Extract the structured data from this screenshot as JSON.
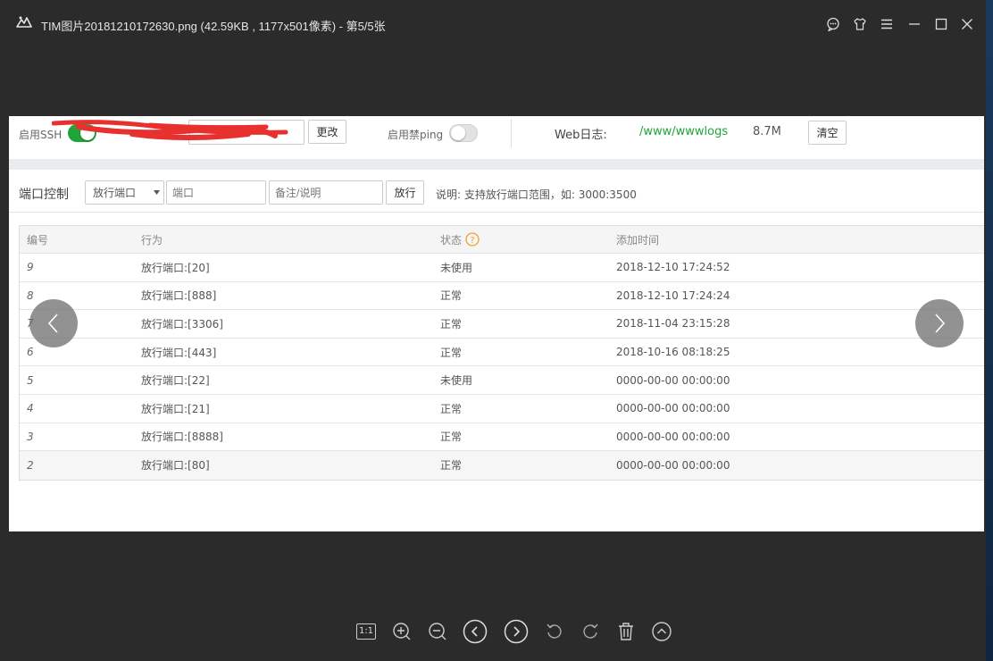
{
  "window": {
    "title": "TIM图片20181210172630.png (42.59KB , 1177x501像素) - 第5/5张",
    "icons": [
      "feedback-icon",
      "skin-icon",
      "menu-icon",
      "minimize-icon",
      "maximize-icon",
      "close-icon"
    ]
  },
  "panel": {
    "ssh_label": "启用SSH",
    "ssh_enabled": true,
    "change_button": "更改",
    "ping_label": "启用禁ping",
    "ping_enabled": false,
    "weblog_label": "Web日志:",
    "weblog_path": "/www/wwwlogs",
    "weblog_size": "8.7M",
    "clear_button": "清空",
    "port_section_title": "端口控制",
    "action_select": "放行端口",
    "port_placeholder": "端口",
    "note_placeholder": "备注/说明",
    "allow_button": "放行",
    "hint": "说明: 支持放行端口范围，如: 3000:3500",
    "accent_color": "#20a53a"
  },
  "table": {
    "headers": {
      "id": "编号",
      "action": "行为",
      "status": "状态",
      "time": "添加时间"
    },
    "rows": [
      {
        "id": "9",
        "action": "放行端口:[20]",
        "status": "未使用",
        "time": "2018-12-10 17:24:52"
      },
      {
        "id": "8",
        "action": "放行端口:[888]",
        "status": "正常",
        "time": "2018-12-10 17:24:24"
      },
      {
        "id": "7",
        "action": "放行端口:[3306]",
        "status": "正常",
        "time": "2018-11-04 23:15:28"
      },
      {
        "id": "6",
        "action": "放行端口:[443]",
        "status": "正常",
        "time": "2018-10-16 08:18:25"
      },
      {
        "id": "5",
        "action": "放行端口:[22]",
        "status": "未使用",
        "time": "0000-00-00 00:00:00"
      },
      {
        "id": "4",
        "action": "放行端口:[21]",
        "status": "正常",
        "time": "0000-00-00 00:00:00"
      },
      {
        "id": "3",
        "action": "放行端口:[8888]",
        "status": "正常",
        "time": "0000-00-00 00:00:00"
      },
      {
        "id": "2",
        "action": "放行端口:[80]",
        "status": "正常",
        "time": "0000-00-00 00:00:00"
      }
    ]
  },
  "toolbar": {
    "actual_size_label": "1:1",
    "buttons": [
      "actual-size-icon",
      "zoom-in-icon",
      "zoom-out-icon",
      "previous-icon",
      "next-icon",
      "rotate-left-icon",
      "rotate-right-icon",
      "delete-icon",
      "expand-icon"
    ]
  }
}
